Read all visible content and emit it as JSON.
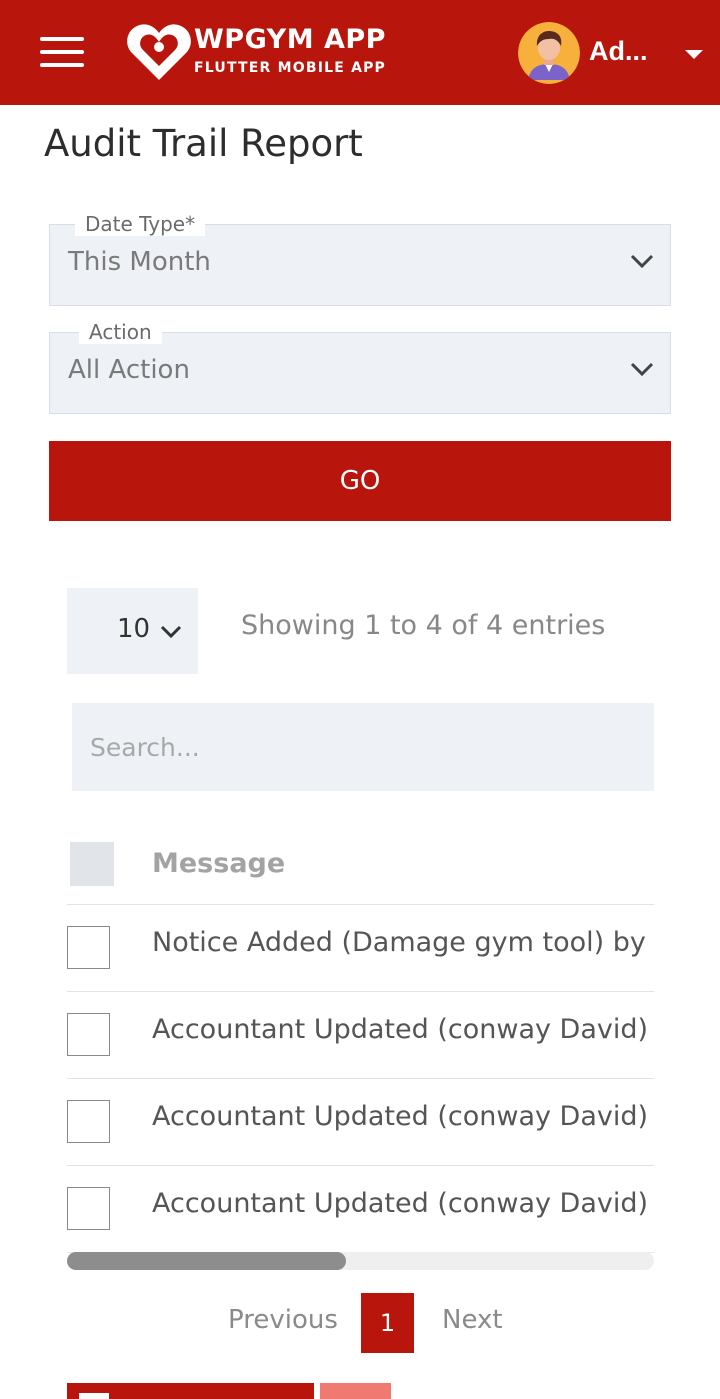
{
  "colors": {
    "brand": "#b8160c",
    "field_bg": "#eef2f7",
    "secondary_button": "#f07a72"
  },
  "header": {
    "menu_icon": "hamburger-icon",
    "logo_icon": "heart-logo-icon",
    "logo_title": "WPGYM APP",
    "logo_subtitle": "FLUTTER MOBILE APP",
    "user_name": "Ad...",
    "user_menu_icon": "caret-down-icon"
  },
  "page": {
    "title": "Audit Trail Report"
  },
  "filters": {
    "date_type": {
      "label": "Date Type*",
      "value": "This Month",
      "icon": "chevron-down-icon"
    },
    "action": {
      "label": "Action",
      "value": "All Action",
      "icon": "chevron-down-icon"
    },
    "go_label": "GO"
  },
  "table_controls": {
    "page_length": "10",
    "entries_info": "Showing 1 to 4 of 4 entries",
    "search_placeholder": "Search..."
  },
  "table": {
    "columns": [
      "Message"
    ],
    "rows": [
      {
        "message": "Notice Added (Damage gym tool) by"
      },
      {
        "message": "Accountant Updated (conway David)"
      },
      {
        "message": "Accountant Updated (conway David)"
      },
      {
        "message": "Accountant Updated (conway David)"
      }
    ]
  },
  "pagination": {
    "previous": "Previous",
    "current": "1",
    "next": "Next"
  }
}
